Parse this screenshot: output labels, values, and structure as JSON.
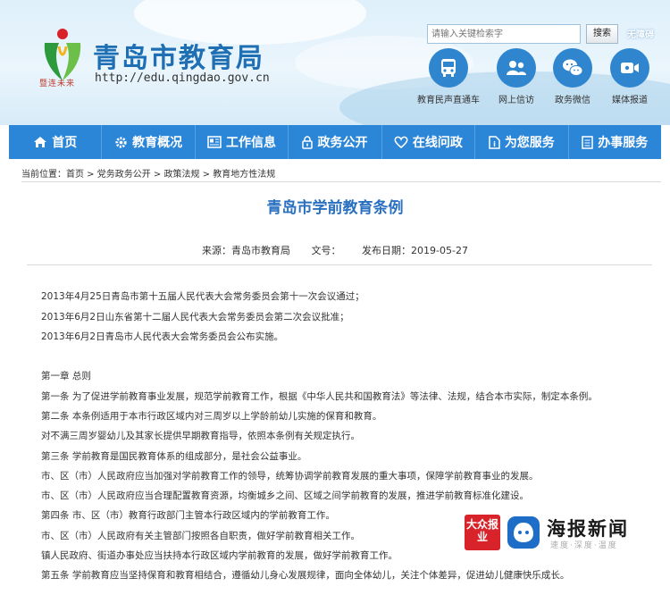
{
  "site": {
    "title": "青岛市教育局",
    "url": "http://edu.qingdao.gov.cn",
    "logo_script": "暨连未来"
  },
  "search": {
    "placeholder": "请输入关键检索字",
    "button_label": "搜索",
    "accessibility_label": "无障碍"
  },
  "quick_links": [
    {
      "label": "教育民声直通车",
      "icon": "bus-icon"
    },
    {
      "label": "网上信访",
      "icon": "people-icon"
    },
    {
      "label": "政务微信",
      "icon": "wechat-icon"
    },
    {
      "label": "媒体报道",
      "icon": "video-icon"
    }
  ],
  "nav": [
    {
      "label": "首页",
      "icon": "home-icon"
    },
    {
      "label": "教育概况",
      "icon": "gear-icon"
    },
    {
      "label": "工作信息",
      "icon": "newspaper-icon"
    },
    {
      "label": "政务公开",
      "icon": "lock-icon"
    },
    {
      "label": "在线问政",
      "icon": "heart-icon"
    },
    {
      "label": "为您服务",
      "icon": "document-icon"
    },
    {
      "label": "办事服务",
      "icon": "list-icon"
    }
  ],
  "breadcrumb": {
    "prefix": "当前位置：",
    "items": [
      "首页",
      "党务政务公开",
      "政策法规",
      "教育地方性法规"
    ],
    "separator": " > "
  },
  "article": {
    "title": "青岛市学前教育条例",
    "source": "来源：青岛市教育局",
    "doc_number": "文号：",
    "publish_date": "发布日期：2019-05-27",
    "lines": [
      "2013年4月25日青岛市第十五届人民代表大会常务委员会第十一次会议通过；",
      "2013年6月2日山东省第十二届人民代表大会常务委员会第二次会议批准；",
      "2013年6月2日青岛市人民代表大会常务委员会公布实施。",
      "第一章 总则",
      "第一条 为了促进学前教育事业发展，规范学前教育工作，根据《中华人民共和国教育法》等法律、法规，结合本市实际，制定本条例。",
      "第二条 本条例适用于本市行政区域内对三周岁以上学龄前幼儿实施的保育和教育。",
      "对不满三周岁婴幼儿及其家长提供早期教育指导，依照本条例有关规定执行。",
      "第三条 学前教育是国民教育体系的组成部分，是社会公益事业。",
      "市、区（市）人民政府应当加强对学前教育工作的领导，统筹协调学前教育发展的重大事项，保障学前教育事业的发展。",
      "市、区（市）人民政府应当合理配置教育资源，均衡城乡之间、区域之间学前教育的发展，推进学前教育标准化建设。",
      "第四条 市、区（市）教育行政部门主管本行政区域内的学前教育工作。",
      "市、区（市）人民政府有关主管部门按照各自职责，做好学前教育相关工作。",
      "镇人民政府、街道办事处应当扶持本行政区域内学前教育的发展，做好学前教育工作。",
      "第五条 学前教育应当坚持保育和教育相结合，遵循幼儿身心发展规律，面向全体幼儿，关注个体差异，促进幼儿健康快乐成长。"
    ]
  },
  "watermark": {
    "badge": "大众报业",
    "name": "海报新闻",
    "slogan": "速度·深度·温度"
  },
  "colors": {
    "nav_bg": "#2b86d8",
    "title_blue": "#2a70c0",
    "brand_blue": "#1f6fb5"
  }
}
